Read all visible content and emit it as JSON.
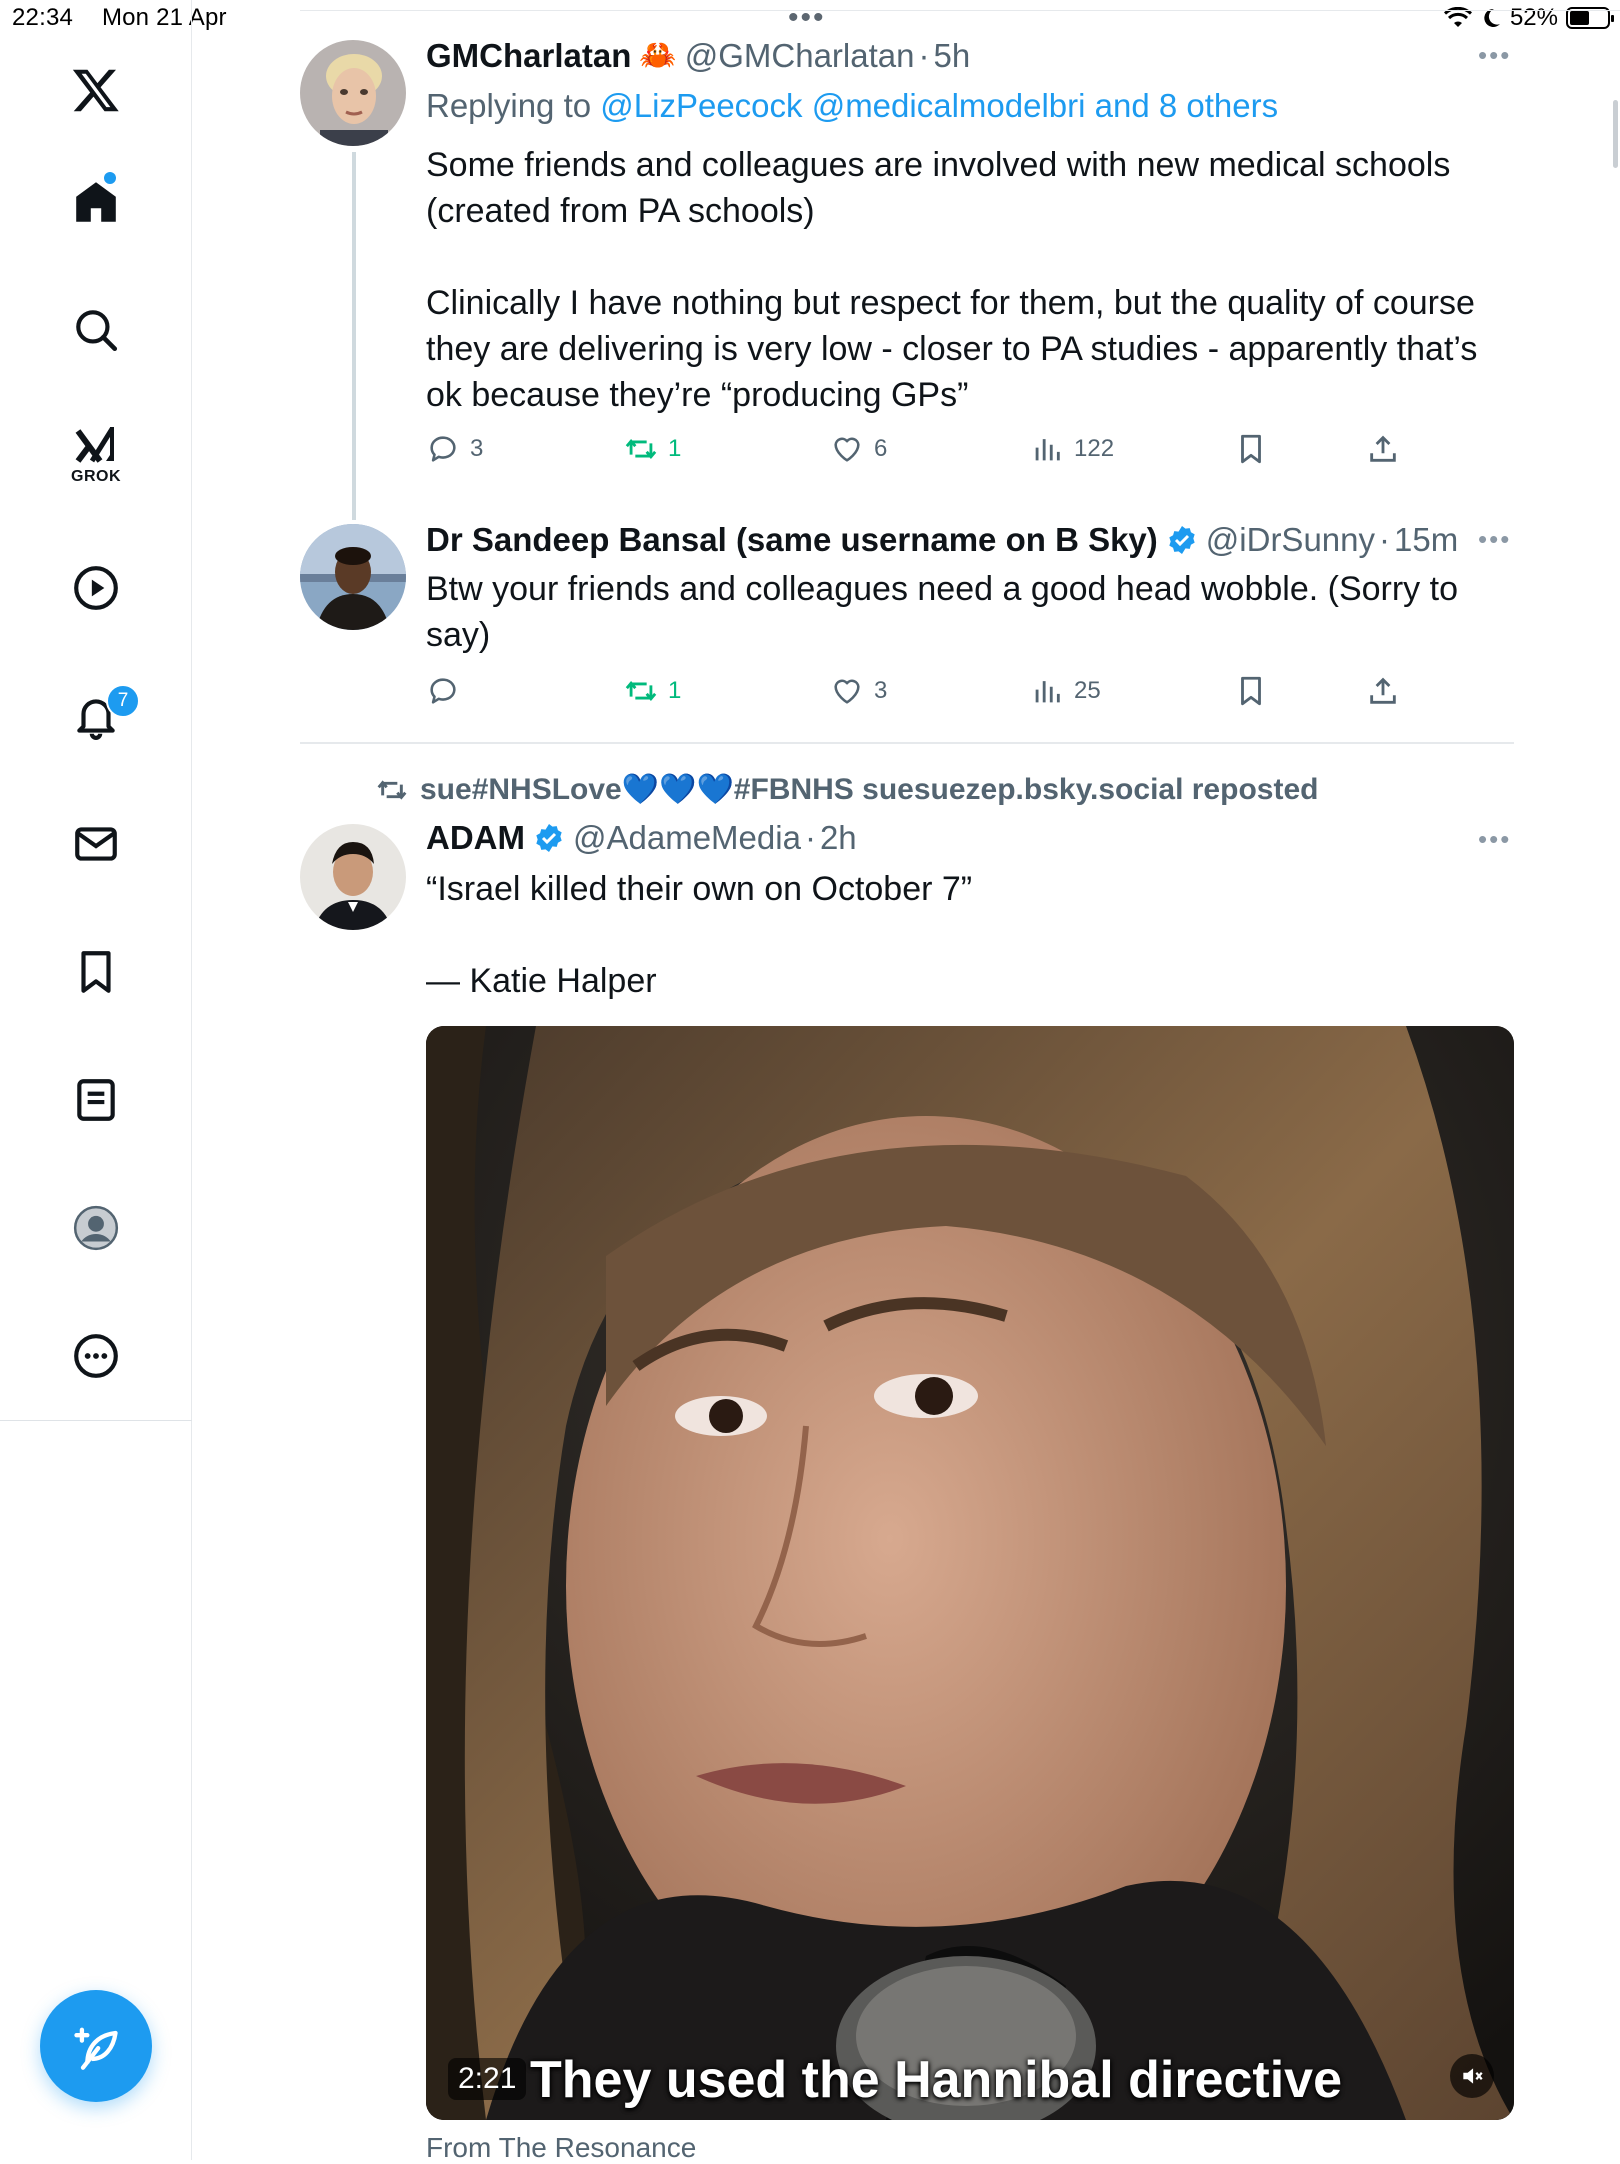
{
  "status_bar": {
    "time": "22:34",
    "date": "Mon 21 Apr",
    "battery": "52%",
    "battery_level": 0.52
  },
  "sidebar": {
    "grok_label": "GROK",
    "notification_count": "7"
  },
  "tweets": [
    {
      "name": "GMCharlatan",
      "name_emoji": "🦀",
      "handle": "@GMCharlatan",
      "time": "5h",
      "replying_label": "Replying to ",
      "replying_to": "@LizPeecock @medicalmodelbri and 8 others",
      "text": "Some friends and colleagues are involved with new medical schools\n(created from PA schools)\n\nClinically I have nothing but respect for them, but the quality of course\nthey are delivering is very low - closer to PA studies - apparently that’s\nok because they’re “producing GPs”",
      "replies": "3",
      "reposts": "1",
      "likes": "6",
      "views": "122"
    },
    {
      "name": "Dr Sandeep Bansal (same username on B Sky)",
      "handle": "@iDrSunny",
      "time": "15m",
      "text": "Btw your friends and colleagues need a good head wobble. (Sorry to\nsay)",
      "replies": "",
      "reposts": "1",
      "likes": "3",
      "views": "25"
    },
    {
      "repost_by": "sue#NHSLove💙💙💙#FBNHS suesuezep.bsky.social reposted",
      "name": "ADAM",
      "handle": "@AdameMedia",
      "time": "2h",
      "text": "“Israel killed their own on October 7”\n\n— Katie Halper",
      "video": {
        "duration": "2:21",
        "caption": "They used the Hannibal directive",
        "source": "From The Resonance"
      }
    }
  ],
  "colors": {
    "accent": "#1d9bf0",
    "repost_green": "#00ba7c",
    "secondary_text": "#536471"
  }
}
